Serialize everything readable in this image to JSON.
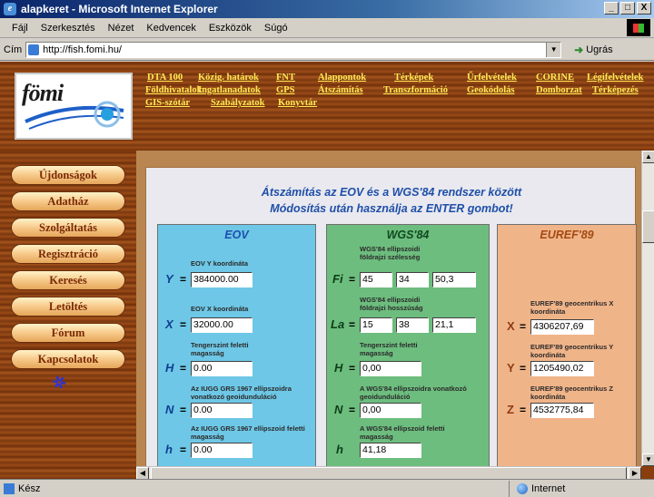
{
  "window": {
    "title": "alapkeret - Microsoft Internet Explorer",
    "buttons": [
      "_",
      "□",
      "X"
    ]
  },
  "menu": [
    "Fájl",
    "Szerkesztés",
    "Nézet",
    "Kedvencek",
    "Eszközök",
    "Súgó"
  ],
  "address": {
    "label": "Cím",
    "url": "http://fish.fomi.hu/",
    "go_label": "Ugrás"
  },
  "logo": {
    "text": "fömi"
  },
  "nav": [
    [
      "DTA 100",
      "Közig. határok",
      "FNT",
      "Alappontok",
      "Térképek",
      "Űrfelvételek",
      "CORINE",
      "Légifelvételek"
    ],
    [
      "Földhivatalok",
      "Ingatlanadatok",
      "GPS",
      "Átszámítás",
      "Transzformáció",
      "Geokódolás",
      "Domborzat",
      "Térképezés"
    ],
    [
      "GIS-szótár",
      "Szabályzatok",
      "Konyvtár"
    ]
  ],
  "sidebar": [
    "Újdonságok",
    "Adatház",
    "Szolgáltatás",
    "Regisztráció",
    "Keresés",
    "Letöltés",
    "Fórum",
    "Kapcsolatok"
  ],
  "main": {
    "title_line1": "Átszámítás az EOV és a WGS'84 rendszer között",
    "title_line2": "Módosítás után használja az ENTER gombot!"
  },
  "eov": {
    "title": "EOV",
    "y_label": "EOV Y koordináta",
    "y_var": "Y",
    "y_value": "384000.00",
    "x_label": "EOV X koordináta",
    "x_var": "X",
    "x_value": "32000.00",
    "h_label": "Tengerszint feletti magasság",
    "h_var": "H",
    "h_value": "0.00",
    "n_label": "Az IUGG GRS 1967 ellipszoidra vonatkozó geoidunduláció",
    "n_var": "N",
    "n_value": "0.00",
    "hh_label": "Az IUGG GRS 1967 ellipszoid feletti magasság",
    "hh_var": "h",
    "hh_value": "0.00"
  },
  "wgs": {
    "title": "WGS'84",
    "fi_label": "WGS'84 ellipszoidi földrajzi szélesség",
    "fi_var": "Fi",
    "fi_deg": "45",
    "fi_min": "34",
    "fi_sec": "50,3",
    "la_label": "WGS'84 ellipszoidi földrajzi hosszúság",
    "la_var": "La",
    "la_deg": "15",
    "la_min": "38",
    "la_sec": "21,1",
    "h_label": "Tengerszint feletti magasság",
    "h_var": "H",
    "h_value": "0,00",
    "n_label": "A WGS'84 ellipszoidra vonatkozó geoidunduláció",
    "n_var": "N",
    "n_value": "0,00",
    "hh_label": "A WGS'84 ellipszoid feletti magasság",
    "hh_var": "h",
    "hh_value": "41,18"
  },
  "euref": {
    "title": "EUREF'89",
    "x_label": "EUREF'89 geocentrikus X koordináta",
    "x_var": "X",
    "x_value": "4306207,69",
    "y_label": "EUREF'89 geocentrikus Y koordináta",
    "y_var": "Y",
    "y_value": "1205490,02",
    "z_label": "EUREF'89 geocentrikus Z koordináta",
    "z_var": "Z",
    "z_value": "4532775,84"
  },
  "status": {
    "left": "Kész",
    "zone": "Internet"
  }
}
